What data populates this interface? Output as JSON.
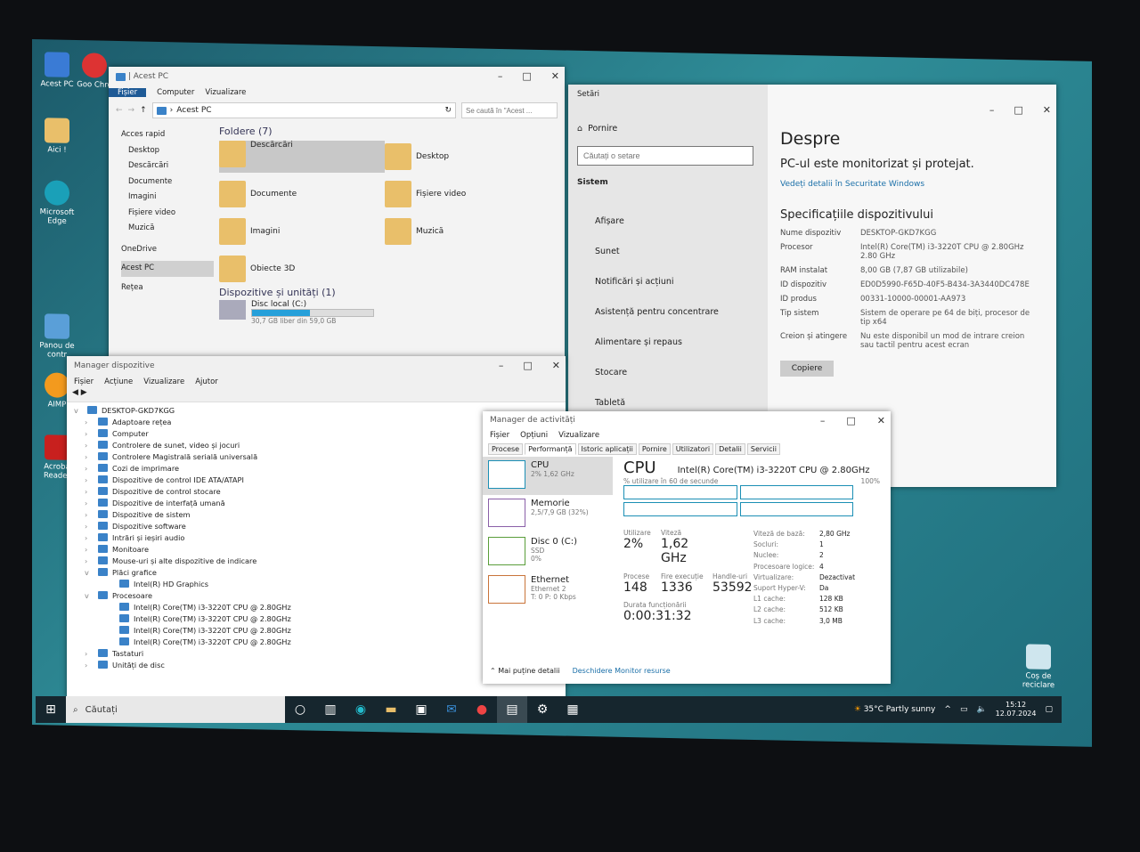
{
  "desktop": {
    "icons": [
      {
        "label": "Acest PC"
      },
      {
        "label": "Goo Chro"
      },
      {
        "label": "Aici !"
      },
      {
        "label": "Microsoft Edge"
      },
      {
        "label": "Panou de contr"
      },
      {
        "label": "AIMP"
      },
      {
        "label": "Acroba Reader"
      },
      {
        "label": "Coș de reciclare"
      }
    ]
  },
  "explorer": {
    "title": "Acest PC",
    "ribbon_tabs": [
      "Fișier",
      "Computer",
      "Vizualizare"
    ],
    "address": "Acest PC",
    "search_placeholder": "Se caută în \"Acest ...",
    "nav": [
      {
        "label": "Acces rapid"
      },
      {
        "label": "Desktop"
      },
      {
        "label": "Descărcări"
      },
      {
        "label": "Documente"
      },
      {
        "label": "Imagini"
      },
      {
        "label": "Fișiere video"
      },
      {
        "label": "Muzică"
      },
      {
        "label": "OneDrive"
      },
      {
        "label": "Acest PC"
      },
      {
        "label": "Rețea"
      }
    ],
    "folders_header": "Foldere (7)",
    "folders": [
      "Descărcări",
      "Desktop",
      "Documente",
      "Fișiere video",
      "Imagini",
      "Muzică",
      "Obiecte 3D"
    ],
    "devices_header": "Dispozitive și unități (1)",
    "drive": {
      "name": "Disc local (C:)",
      "free": "30,7 GB liber din 59,0 GB",
      "used_fraction": 0.48
    }
  },
  "settings": {
    "title": "Setări",
    "home": "Pornire",
    "search_placeholder": "Căutați o setare",
    "section": "Sistem",
    "nav": [
      "Afișare",
      "Sunet",
      "Notificări și acțiuni",
      "Asistență pentru concentrare",
      "Alimentare și repaus",
      "Stocare",
      "Tabletă"
    ],
    "heading": "Despre",
    "protected": "PC-ul este monitorizat și protejat.",
    "security_link": "Vedeți detalii în Securitate Windows",
    "specs_heading": "Specificațiile dispozitivului",
    "specs": [
      {
        "k": "Nume dispozitiv",
        "v": "DESKTOP-GKD7KGG"
      },
      {
        "k": "Procesor",
        "v": "Intel(R) Core(TM) i3-3220T CPU @ 2.80GHz 2.80 GHz"
      },
      {
        "k": "RAM instalat",
        "v": "8,00 GB (7,87 GB utilizabile)"
      },
      {
        "k": "ID dispozitiv",
        "v": "ED0D5990-F65D-40F5-B434-3A3440DC478E"
      },
      {
        "k": "ID produs",
        "v": "00331-10000-00001-AA973"
      },
      {
        "k": "Tip sistem",
        "v": "Sistem de operare pe 64 de biți, procesor de tip x64"
      },
      {
        "k": "Creion și atingere",
        "v": "Nu este disponibil un mod de intrare creion sau tactil pentru acest ecran"
      }
    ],
    "copy_button": "Copiere"
  },
  "devmgr": {
    "title": "Manager dispozitive",
    "menu": [
      "Fișier",
      "Acțiune",
      "Vizualizare",
      "Ajutor"
    ],
    "root": "DESKTOP-GKD7KGG",
    "items": [
      "Adaptoare rețea",
      "Computer",
      "Controlere de sunet, video și jocuri",
      "Controlere Magistrală serială universală",
      "Cozi de imprimare",
      "Dispozitive de control IDE ATA/ATAPI",
      "Dispozitive de control stocare",
      "Dispozitive de interfață umană",
      "Dispozitive de sistem",
      "Dispozitive software",
      "Intrări și ieșiri audio",
      "Monitoare",
      "Mouse-uri și alte dispozitive de indicare"
    ],
    "graphics": "Plăci grafice",
    "gpu": "Intel(R) HD Graphics",
    "processors": "Procesoare",
    "cpus": [
      "Intel(R) Core(TM) i3-3220T CPU @ 2.80GHz",
      "Intel(R) Core(TM) i3-3220T CPU @ 2.80GHz",
      "Intel(R) Core(TM) i3-3220T CPU @ 2.80GHz",
      "Intel(R) Core(TM) i3-3220T CPU @ 2.80GHz"
    ],
    "after": [
      "Tastaturi",
      "Unități de disc"
    ]
  },
  "taskmgr": {
    "title": "Manager de activități",
    "menu": [
      "Fișier",
      "Opțiuni",
      "Vizualizare"
    ],
    "tabs": [
      "Procese",
      "Performanță",
      "Istoric aplicații",
      "Pornire",
      "Utilizatori",
      "Detalii",
      "Servicii"
    ],
    "side": [
      {
        "name": "CPU",
        "sub": "2% 1,62 GHz"
      },
      {
        "name": "Memorie",
        "sub": "2,5/7,9 GB (32%)"
      },
      {
        "name": "Disc 0 (C:)",
        "sub": "SSD",
        "sub2": "0%"
      },
      {
        "name": "Ethernet",
        "sub": "Ethernet 2",
        "sub2": "T: 0 P: 0 Kbps"
      }
    ],
    "heading": "CPU",
    "cpu_name": "Intel(R) Core(TM) i3-3220T CPU @ 2.80GHz",
    "graph_label": "% utilizare în 60 de secunde",
    "graph_max": "100%",
    "stats": [
      {
        "k": "Utilizare",
        "v": "2%"
      },
      {
        "k": "Viteză",
        "v": "1,62 GHz"
      },
      {
        "k": "Procese",
        "v": "148"
      },
      {
        "k": "Fire execuție",
        "v": "1336"
      },
      {
        "k": "Handle-uri",
        "v": "53592"
      },
      {
        "k": "Durata funcționării",
        "v": "0:00:31:32"
      }
    ],
    "details": [
      {
        "k": "Viteză de bază:",
        "v": "2,80 GHz"
      },
      {
        "k": "Socluri:",
        "v": "1"
      },
      {
        "k": "Nuclee:",
        "v": "2"
      },
      {
        "k": "Procesoare logice:",
        "v": "4"
      },
      {
        "k": "Virtualizare:",
        "v": "Dezactivat"
      },
      {
        "k": "Suport Hyper-V:",
        "v": "Da"
      },
      {
        "k": "L1 cache:",
        "v": "128 KB"
      },
      {
        "k": "L2 cache:",
        "v": "512 KB"
      },
      {
        "k": "L3 cache:",
        "v": "3,0 MB"
      }
    ],
    "fewer": "Mai puține detalii",
    "monitor": "Deschidere Monitor resurse"
  },
  "taskbar": {
    "search": "Căutați",
    "weather": "35°C  Partly sunny",
    "time": "15:12",
    "date": "12.07.2024"
  },
  "colors": {
    "accent": "#1b8fb5",
    "desktop": "#2f8d98"
  }
}
